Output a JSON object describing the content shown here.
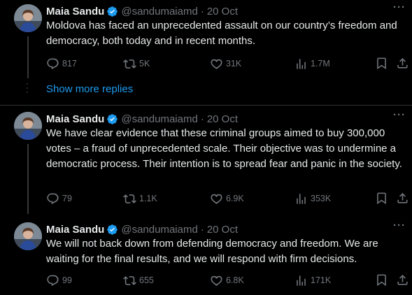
{
  "tweets": [
    {
      "name": "Maia Sandu",
      "handle": "@sandumaiamd",
      "time": "20 Oct",
      "text": "Moldova has faced an unprecedented assault on our country’s freedom and democracy, both today and in recent months.",
      "replies": "817",
      "retweets": "5K",
      "likes": "31K",
      "views": "1.7M"
    },
    {
      "name": "Maia Sandu",
      "handle": "@sandumaiamd",
      "time": "20 Oct",
      "text": "We have clear evidence that these criminal groups aimed to buy 300,000 votes – a fraud of unprecedented scale. Their objective was to undermine a democratic process. Their intention is to spread fear and panic in the society.",
      "replies": "79",
      "retweets": "1.1K",
      "likes": "6.9K",
      "views": "353K"
    },
    {
      "name": "Maia Sandu",
      "handle": "@sandumaiamd",
      "time": "20 Oct",
      "text": "We will not back down from defending democracy and freedom. We are waiting for the final results, and we will respond with firm decisions.",
      "replies": "99",
      "retweets": "655",
      "likes": "6.8K",
      "views": "171K"
    }
  ],
  "show_more_replies": "Show more replies",
  "separator": "·",
  "more_glyph": "···",
  "colors": {
    "background": "#000000",
    "text": "#e7e9ea",
    "muted": "#71767b",
    "link": "#1d9bf0",
    "verified": "#1d9bf0"
  },
  "icons": [
    "verified-badge-icon",
    "more-icon",
    "reply-icon",
    "retweet-icon",
    "like-icon",
    "views-icon",
    "bookmark-icon",
    "share-icon"
  ]
}
